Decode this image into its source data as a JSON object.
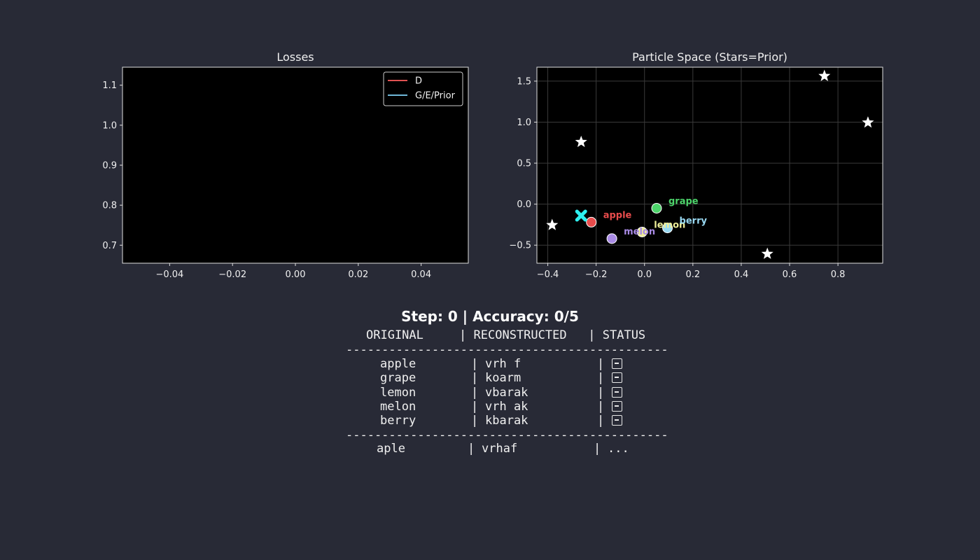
{
  "chart_data": [
    {
      "type": "line",
      "title": "Losses",
      "xlim": [
        -0.055,
        0.055
      ],
      "ylim": [
        0.655,
        1.145
      ],
      "xticks": [
        -0.04,
        -0.02,
        0.0,
        0.02,
        0.04
      ],
      "xtick_labels": [
        "−0.04",
        "−0.02",
        "0.00",
        "0.02",
        "0.04"
      ],
      "yticks": [
        0.7,
        0.8,
        0.9,
        1.0,
        1.1
      ],
      "ytick_labels": [
        "0.7",
        "0.8",
        "0.9",
        "1.0",
        "1.1"
      ],
      "grid": false,
      "legend_position": "top-right",
      "series": [
        {
          "name": "D",
          "color": "#e05252",
          "x": [],
          "y": []
        },
        {
          "name": "G/E/Prior",
          "color": "#6fb7d8",
          "x": [],
          "y": []
        }
      ]
    },
    {
      "type": "scatter",
      "title": "Particle Space (Stars=Prior)",
      "xlim": [
        -0.445,
        0.985
      ],
      "ylim": [
        -0.72,
        1.67
      ],
      "xticks": [
        -0.4,
        -0.2,
        0.0,
        0.2,
        0.4,
        0.6,
        0.8
      ],
      "xtick_labels": [
        "−0.4",
        "−0.2",
        "0.0",
        "0.2",
        "0.4",
        "0.6",
        "0.8"
      ],
      "yticks": [
        -0.5,
        0.0,
        0.5,
        1.0,
        1.5
      ],
      "ytick_labels": [
        "−0.5",
        "0.0",
        "0.5",
        "1.0",
        "1.5"
      ],
      "grid": true,
      "prior_stars": [
        {
          "x": -0.262,
          "y": 0.758
        },
        {
          "x": 0.744,
          "y": 1.563
        },
        {
          "x": 0.924,
          "y": 0.995
        },
        {
          "x": -0.382,
          "y": -0.255
        },
        {
          "x": 0.508,
          "y": -0.606
        }
      ],
      "particles": [
        {
          "label": "apple",
          "x": -0.22,
          "y": -0.22,
          "color": "#e84c4c"
        },
        {
          "label": "grape",
          "x": 0.05,
          "y": -0.05,
          "color": "#4cd46a"
        },
        {
          "label": "lemon",
          "x": -0.01,
          "y": -0.34,
          "color": "#eeee99"
        },
        {
          "label": "melon",
          "x": -0.135,
          "y": -0.42,
          "color": "#a98be6"
        },
        {
          "label": "berry",
          "x": 0.095,
          "y": -0.29,
          "color": "#99d9f2"
        }
      ],
      "cross_marker": {
        "x": -0.262,
        "y": -0.14,
        "color": "#2ef0f0"
      }
    }
  ],
  "summary": {
    "text": "Step: 0 | Accuracy: 0/5"
  },
  "table": {
    "header": "ORIGINAL     | RECONSTRUCTED   | STATUS",
    "separator": "---------------------------------------------",
    "rows": [
      {
        "original": "apple",
        "reconstructed": "vrh f"
      },
      {
        "original": "grape",
        "reconstructed": "koarm"
      },
      {
        "original": "lemon",
        "reconstructed": "vbarak"
      },
      {
        "original": "melon",
        "reconstructed": "vrh ak"
      },
      {
        "original": "berry",
        "reconstructed": "kbarak"
      }
    ],
    "status_icon": "x-box-icon",
    "footer_original": "aple",
    "footer_reconstructed": "vrhaf",
    "footer_status": "..."
  }
}
